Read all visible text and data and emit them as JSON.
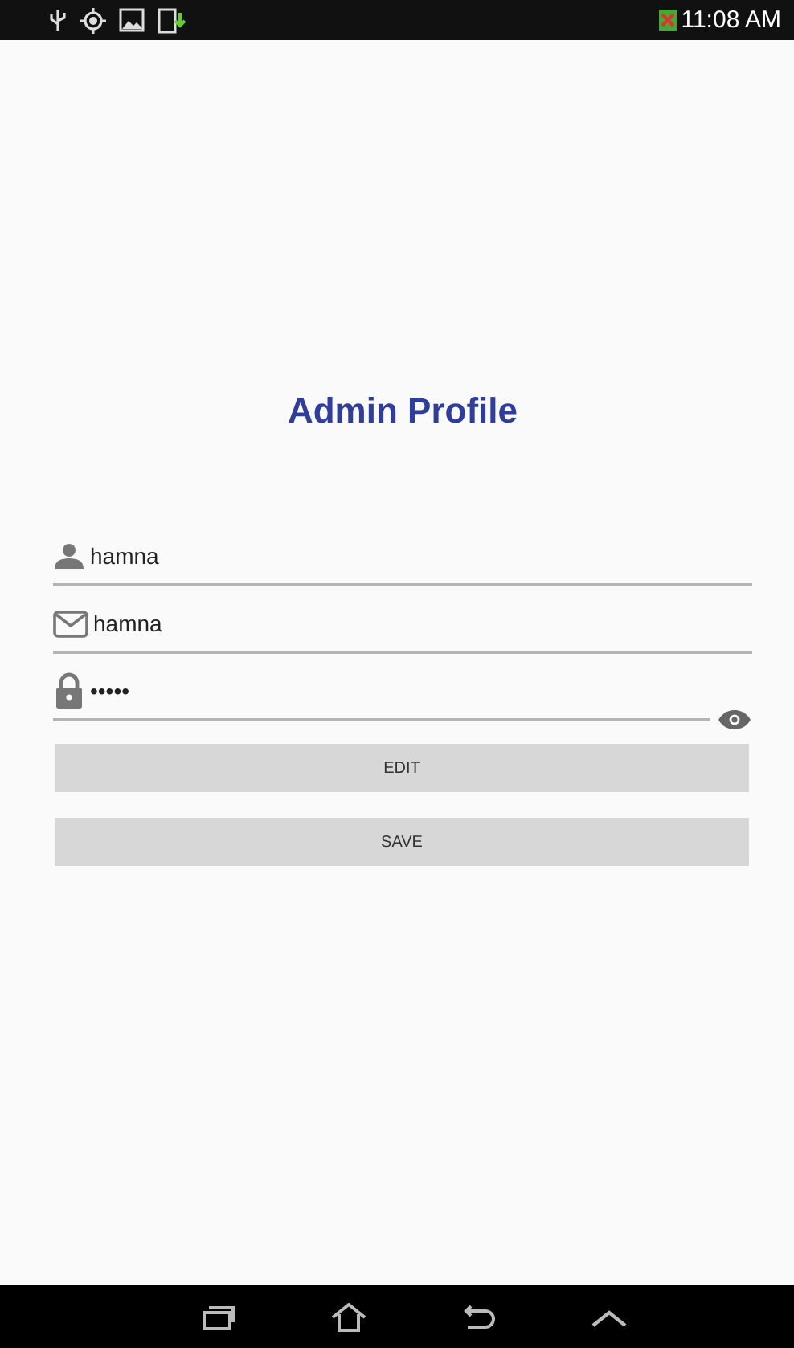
{
  "status_bar": {
    "time": "11:08 AM"
  },
  "title": "Admin Profile",
  "fields": [
    {
      "kind": "user",
      "value": "hamna"
    },
    {
      "kind": "email",
      "value": "hamna"
    },
    {
      "kind": "password",
      "value": "•••••"
    }
  ],
  "buttons": [
    "EDIT",
    "SAVE"
  ]
}
